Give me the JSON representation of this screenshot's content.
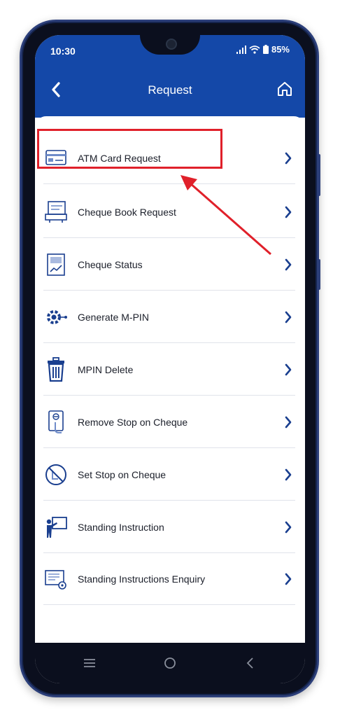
{
  "status_bar": {
    "time": "10:30",
    "battery": "85%"
  },
  "header": {
    "title": "Request",
    "back_icon": "chevron-left-icon",
    "home_icon": "home-icon"
  },
  "menu": {
    "items": [
      {
        "label": "ATM Card Request",
        "icon": "atm-card-icon"
      },
      {
        "label": "Cheque Book Request",
        "icon": "cheque-book-icon"
      },
      {
        "label": "Cheque Status",
        "icon": "cheque-status-icon"
      },
      {
        "label": "Generate M-PIN",
        "icon": "gear-pin-icon"
      },
      {
        "label": "MPIN Delete",
        "icon": "trash-icon"
      },
      {
        "label": "Remove Stop on Cheque",
        "icon": "remove-stop-cheque-icon"
      },
      {
        "label": "Set Stop on Cheque",
        "icon": "stop-cheque-icon"
      },
      {
        "label": "Standing Instruction",
        "icon": "teacher-board-icon"
      },
      {
        "label": "Standing Instructions Enquiry",
        "icon": "document-enquiry-icon"
      }
    ]
  },
  "colors": {
    "header_bg": "#1448a8",
    "icon": "#1a3f8f",
    "highlight": "#e0202a"
  }
}
